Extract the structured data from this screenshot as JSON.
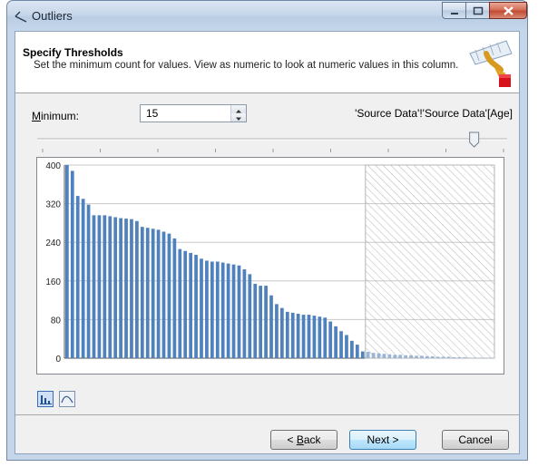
{
  "window": {
    "title": "Outliers",
    "accent": "#c5d6ea"
  },
  "header": {
    "title": "Specify Thresholds",
    "subtitle": "Set the minimum count for values.  View as numeric to look at numeric values in this column."
  },
  "minimum": {
    "label_accel": "M",
    "label_rest": "inimum:",
    "value": "15"
  },
  "column_ref": "'Source Data'!'Source Data'[Age]",
  "slider": {
    "level_fraction": 0.94
  },
  "chart_data": {
    "type": "bar",
    "ylim": [
      0,
      400
    ],
    "yticks": [
      "400",
      "320",
      "240",
      "160",
      "80",
      "0"
    ],
    "grid": true,
    "bar_color": "#4f81bd",
    "hatched_from_index": 56,
    "values": [
      400,
      388,
      336,
      330,
      318,
      296,
      296,
      296,
      294,
      292,
      290,
      289,
      288,
      284,
      272,
      270,
      268,
      266,
      262,
      258,
      248,
      226,
      222,
      218,
      214,
      206,
      202,
      200,
      200,
      198,
      196,
      194,
      192,
      184,
      174,
      154,
      150,
      150,
      130,
      112,
      104,
      96,
      94,
      92,
      90,
      90,
      88,
      86,
      84,
      76,
      66,
      56,
      48,
      36,
      28,
      14,
      13,
      11,
      10,
      9,
      8,
      7,
      7,
      6,
      6,
      5,
      5,
      4,
      4,
      3,
      3,
      3,
      2,
      2,
      2,
      1,
      1,
      1,
      1,
      1
    ]
  },
  "view_buttons": [
    "histogram-icon",
    "curve-icon"
  ],
  "footer": {
    "back_accel": "B",
    "back_prefix": "< ",
    "back_rest": "ack",
    "next": "Next >",
    "cancel": "Cancel"
  }
}
